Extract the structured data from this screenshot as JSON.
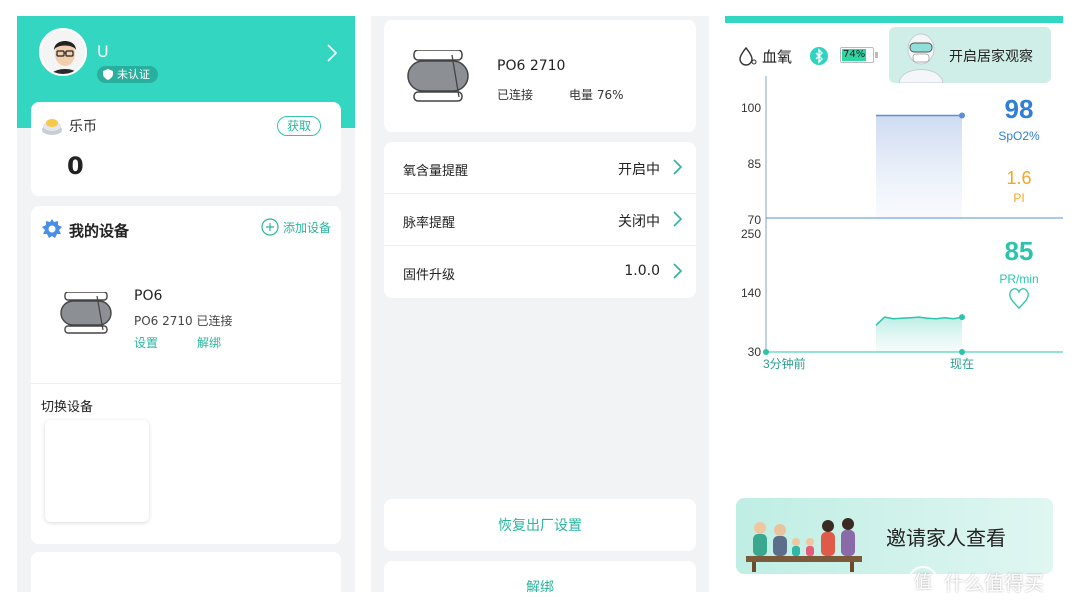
{
  "account": {
    "user_name": "U",
    "verify_badge": "未认证",
    "coin_label": "乐币",
    "coin_value": "0",
    "get_button": "获取"
  },
  "devices": {
    "title": "我的设备",
    "add_button": "添加设备",
    "device_name": "PO6",
    "device_status": "PO6 2710 已连接",
    "settings_link": "设置",
    "unbind_link": "解绑",
    "switch_label": "切换设备"
  },
  "device_detail": {
    "model": "PO6 2710",
    "connection": "已连接",
    "battery": "电量 76%",
    "rows": [
      {
        "label": "氧含量提醒",
        "value": "开启中"
      },
      {
        "label": "脉率提醒",
        "value": "关闭中"
      },
      {
        "label": "固件升级",
        "value": "1.0.0"
      }
    ],
    "reset_button": "恢复出厂设置",
    "unbind_button": "解绑"
  },
  "monitor": {
    "title": "血氧",
    "battery_text": "74%",
    "observe_button": "开启居家观察",
    "spo2_value": "98",
    "spo2_label": "SpO2%",
    "pi_value": "1.6",
    "pi_label": "PI",
    "pr_value": "85",
    "pr_label": "PR/min",
    "x_start_label": "3分钟前",
    "x_end_label": "现在",
    "invite_text": "邀请家人查看",
    "colors": {
      "accent": "#33d6c0",
      "spo2": "#2f7fd8",
      "pi": "#f5a623",
      "pr": "#2bc4ad"
    }
  },
  "chart_data": [
    {
      "type": "area",
      "ylabel": "",
      "ylim": [
        70,
        100
      ],
      "yticks": [
        100,
        85,
        70
      ],
      "series": [
        {
          "values": [
            98,
            98,
            98,
            98,
            98
          ]
        }
      ]
    },
    {
      "type": "area",
      "ylim": [
        30,
        250
      ],
      "yticks": [
        250,
        140,
        30
      ],
      "xtick_labels": [
        "3分钟前",
        "现在"
      ],
      "series": [
        {
          "values": [
            80,
            95,
            92,
            93,
            94,
            95,
            93,
            92,
            94,
            92,
            95
          ]
        }
      ]
    }
  ],
  "watermark": "什么值得买"
}
